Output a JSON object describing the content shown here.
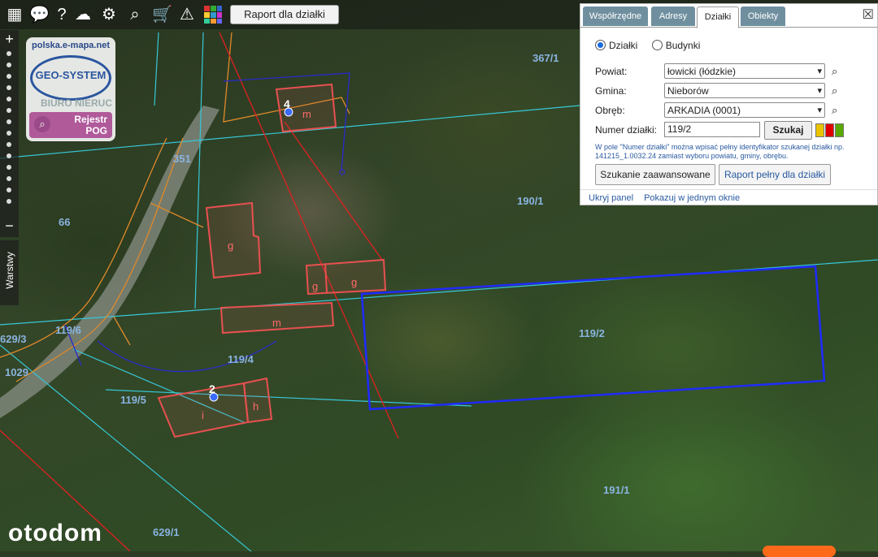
{
  "toolbar": {
    "raport_label": "Raport dla działki"
  },
  "sidebar": {
    "warstwy_label": "Warstwy",
    "zoom_in": "+",
    "zoom_out": "−"
  },
  "logo": {
    "url": "polska.e-mapa.net",
    "brand": "GEO-SYSTEM",
    "brand_sub": "BIURO NIERUC",
    "rejestr_line1": "Rejestr",
    "rejestr_line2": "POG"
  },
  "panel": {
    "tabs": [
      "Współrzędne",
      "Adresy",
      "Działki",
      "Obiekty"
    ],
    "active_tab": "Działki",
    "radio_dzialki": "Działki",
    "radio_budynki": "Budynki",
    "powiat_label": "Powiat:",
    "powiat_value": "łowicki (łódzkie)",
    "gmina_label": "Gmina:",
    "gmina_value": "Nieborów",
    "obreb_label": "Obręb:",
    "obreb_value": "ARKADIA (0001)",
    "numer_label": "Numer działki:",
    "numer_value": "119/2",
    "szukaj_label": "Szukaj",
    "hint_text": "W pole \"Numer działki\" można wpisać pełny identyfikator szukanej działki np. 141215_1.0032.24 zamiast wyboru powiatu, gminy, obrębu.",
    "advanced_label": "Szukanie zaawansowane",
    "raport_full_label": "Raport pełny dla działki",
    "hide_panel": "Ukryj panel",
    "one_window": "Pokazuj w jednym oknie",
    "colors": {
      "yellow": "#e8c400",
      "red": "#e00000",
      "green": "#5aa800"
    }
  },
  "map_labels": {
    "p367_1": "367/1",
    "p351": "351",
    "p66": "66",
    "p190_1": "190/1",
    "p119_2": "119/2",
    "p119_6": "119/6",
    "p119_4": "119/4",
    "p119_5": "119/5",
    "p629_3": "629/3",
    "p1029": "1029",
    "p191_1": "191/1",
    "p629_1": "629/1"
  },
  "building_labels": {
    "m1": "m",
    "g1": "g",
    "g2": "g",
    "g3": "g",
    "m2": "m",
    "h": "h",
    "i": "i"
  },
  "point_labels": {
    "pt4": "4",
    "pt2": "2"
  },
  "watermark": "otodom"
}
